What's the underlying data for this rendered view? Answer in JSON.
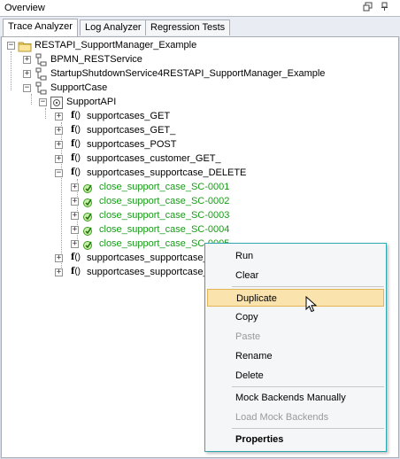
{
  "window": {
    "title": "Overview"
  },
  "tabs": [
    {
      "label": "Trace Analyzer",
      "active": true
    },
    {
      "label": "Log Analyzer",
      "active": false
    },
    {
      "label": "Regression Tests",
      "active": false
    }
  ],
  "tree": {
    "root": "RESTAPI_SupportManager_Example",
    "level1": [
      "BPMN_RESTService",
      "StartupShutdownService4RESTAPI_SupportManager_Example",
      "SupportCase"
    ],
    "service": "SupportAPI",
    "operations": [
      "supportcases_GET",
      "supportcases_GET_",
      "supportcases_POST",
      "supportcases_customer_GET_",
      "supportcases_supportcase_DELETE",
      "supportcases_supportcase_",
      "supportcases_supportcase_"
    ],
    "test_cases": [
      "close_support_case_SC-0001",
      "close_support_case_SC-0002",
      "close_support_case_SC-0003",
      "close_support_case_SC-0004",
      "close_support_case_SC-0005"
    ],
    "fx_glyph": "f",
    "fx_parens": "()"
  },
  "context_menu": {
    "items": [
      {
        "label": "Run",
        "enabled": true
      },
      {
        "label": "Clear",
        "enabled": true
      },
      {
        "label": "Duplicate",
        "enabled": true,
        "highlighted": true
      },
      {
        "label": "Copy",
        "enabled": true
      },
      {
        "label": "Paste",
        "enabled": false
      },
      {
        "label": "Rename",
        "enabled": true
      },
      {
        "label": "Delete",
        "enabled": true
      },
      {
        "label": "Mock Backends Manually",
        "enabled": true
      },
      {
        "label": "Load Mock Backends",
        "enabled": false
      },
      {
        "label": "Properties",
        "enabled": true,
        "bold": true
      }
    ]
  },
  "colors": {
    "test_case_text": "#1a9a1a",
    "menu_highlight": "#fbe3ad",
    "menu_border": "#2fa7b0"
  },
  "icons": {
    "window_restore": "restore-icon",
    "window_pin": "pin-icon",
    "expand": "plus",
    "collapse": "minus"
  }
}
